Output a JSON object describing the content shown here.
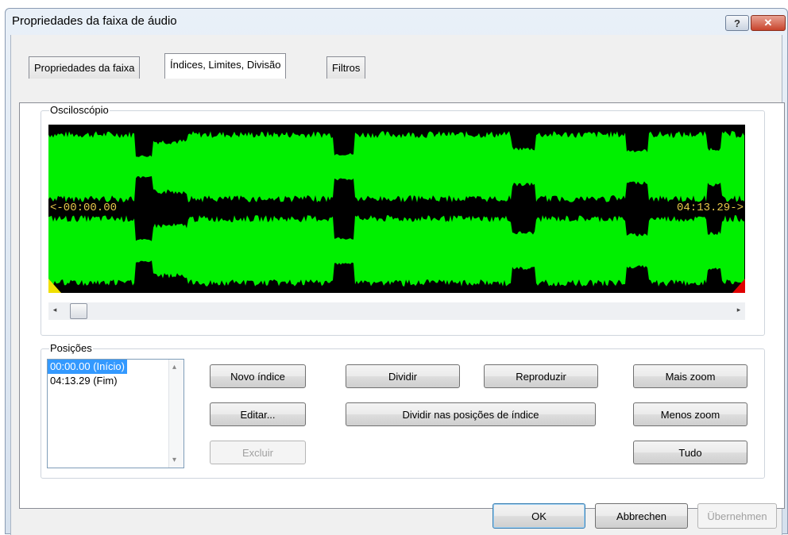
{
  "window": {
    "title": "Propriedades da faixa de áudio",
    "help_glyph": "?",
    "close_glyph": "✕"
  },
  "tabs": [
    {
      "label": "Propriedades da faixa"
    },
    {
      "label": "Índices, Limites, Divisão"
    },
    {
      "label": "Filtros"
    }
  ],
  "oscilloscope": {
    "label": "Osciloscópio",
    "start_time": "<-00:00.00",
    "end_time": "04:13.29->",
    "waveform_color": "#00f000",
    "background_color": "#000000"
  },
  "scrollbar": {
    "left_arrow": "◂",
    "right_arrow": "▸",
    "position_fraction": 0
  },
  "positions": {
    "label": "Posições",
    "items": [
      {
        "label": "00:00.00 (Início)",
        "selected": true
      },
      {
        "label": "04:13.29 (Fim)",
        "selected": false
      }
    ],
    "scroll_up": "▴",
    "scroll_down": "▾"
  },
  "buttons": {
    "new_index": "Novo índice",
    "edit": "Editar...",
    "delete": "Excluir",
    "split": "Dividir",
    "split_at_index": "Dividir nas posições de índice",
    "play": "Reproduzir",
    "zoom_in": "Mais zoom",
    "zoom_out": "Menos zoom",
    "all": "Tudo"
  },
  "footer": {
    "ok": "OK",
    "cancel": "Abbrechen",
    "apply": "Übernehmen"
  },
  "colors": {
    "accent_selection": "#3399ff",
    "start_marker": "#f0e000",
    "end_marker": "#e00000"
  }
}
